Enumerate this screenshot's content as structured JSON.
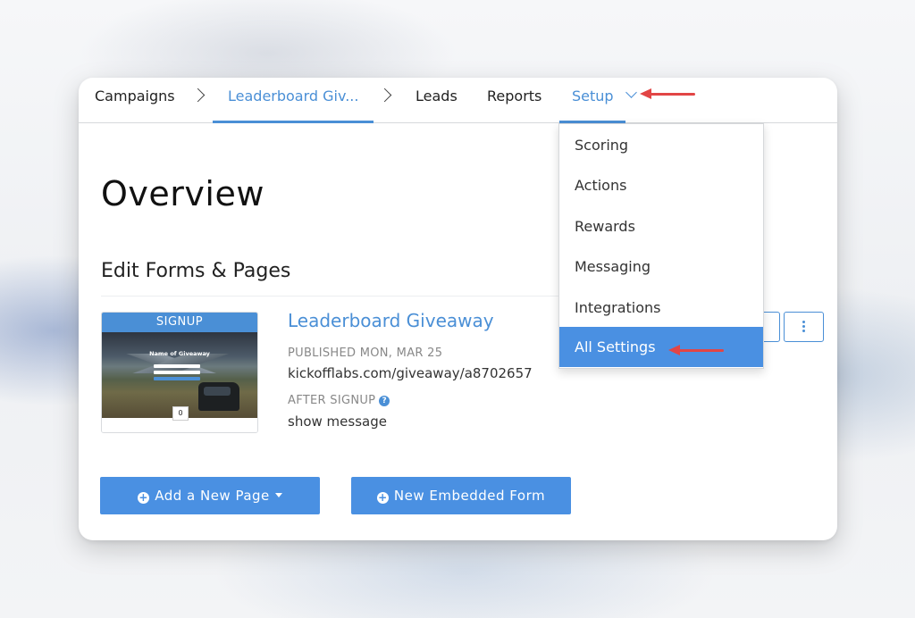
{
  "nav": {
    "items": [
      {
        "label": "Campaigns"
      },
      {
        "label": "Leaderboard Giv..."
      },
      {
        "label": "Leads"
      },
      {
        "label": "Reports"
      },
      {
        "label": "Setup"
      }
    ]
  },
  "main": {
    "title": "Overview",
    "section_title": "Edit Forms & Pages",
    "page": {
      "thumb_label": "SIGNUP",
      "thumb_heading": "Name of Giveaway",
      "thumb_counter": "0",
      "name": "Leaderboard Giveaway",
      "published": "PUBLISHED MON, MAR 25",
      "url": "kickofflabs.com/giveaway/a8702657",
      "after_signup_label": "AFTER SIGNUP",
      "after_signup_value": "show message"
    },
    "buttons": {
      "add_page": "Add a New Page",
      "new_form": "New Embedded Form"
    }
  },
  "dropdown": {
    "items": [
      {
        "label": "Scoring"
      },
      {
        "label": "Actions"
      },
      {
        "label": "Rewards"
      },
      {
        "label": "Messaging"
      },
      {
        "label": "Integrations"
      },
      {
        "label": "All Settings"
      }
    ],
    "selected": "All Settings"
  },
  "colors": {
    "accent": "#4a8fd6",
    "button": "#4a90e2",
    "annotation_arrow": "#e24545"
  }
}
